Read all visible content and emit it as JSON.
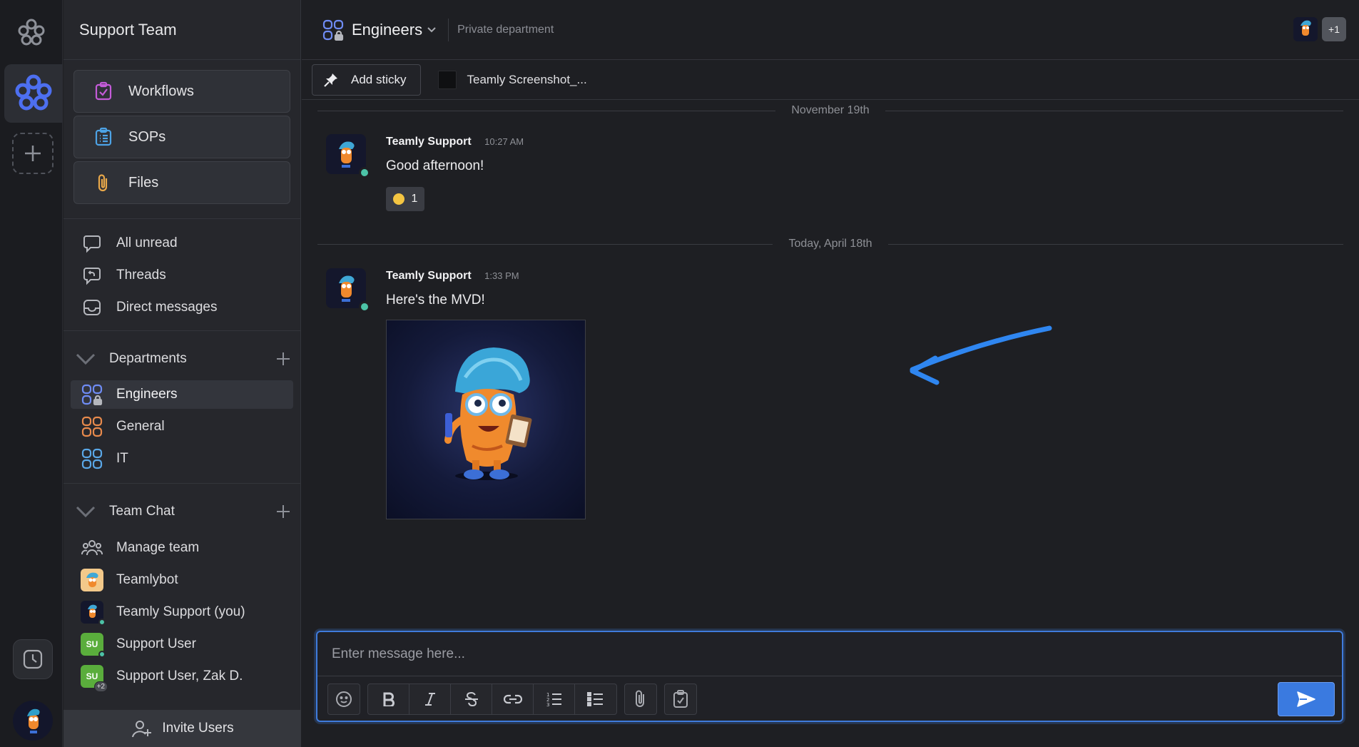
{
  "workspace": {
    "name": "Support Team"
  },
  "sidebar": {
    "big_buttons": [
      {
        "label": "Workflows",
        "icon": "workflows-icon"
      },
      {
        "label": "SOPs",
        "icon": "sops-icon"
      },
      {
        "label": "Files",
        "icon": "paperclip-icon"
      }
    ],
    "nav": [
      {
        "label": "All unread",
        "icon": "chat-bubble-icon"
      },
      {
        "label": "Threads",
        "icon": "threads-icon"
      },
      {
        "label": "Direct messages",
        "icon": "inbox-icon"
      }
    ],
    "departments": {
      "title": "Departments",
      "items": [
        {
          "label": "Engineers",
          "color": "#6f8cf5",
          "active": true
        },
        {
          "label": "General",
          "color": "#e88a4c"
        },
        {
          "label": "IT",
          "color": "#5aa8e8"
        }
      ]
    },
    "team_chat": {
      "title": "Team Chat",
      "items": [
        {
          "label": "Manage team",
          "icon": "people-icon"
        },
        {
          "label": "Teamlybot",
          "icon": "teamlybot-avatar"
        },
        {
          "label": "Teamly Support (you)",
          "icon": "teamly-support-avatar"
        },
        {
          "label": "Support User",
          "initials": "SU",
          "color": "#5aad3c"
        },
        {
          "label": "Support User, Zak D.",
          "initials": "SU",
          "color": "#5aad3c",
          "extra": "+2"
        }
      ]
    },
    "invite_label": "Invite Users"
  },
  "channel": {
    "title": "Engineers",
    "description": "Private department",
    "members_extra": "+1"
  },
  "stickies": {
    "add_label": "Add sticky",
    "file_tab": "Teamly Screenshot_..."
  },
  "messages": {
    "date1": "November 19th",
    "date2": "Today, April 18th",
    "m1": {
      "author": "Teamly Support",
      "time": "10:27 AM",
      "text": "Good afternoon!",
      "reaction_count": "1"
    },
    "m2": {
      "author": "Teamly Support",
      "time": "1:33 PM",
      "text": "Here's the MVD!"
    }
  },
  "composer": {
    "placeholder": "Enter message here..."
  },
  "colors": {
    "accent": "#3a7ae0",
    "online": "#4cc3a7",
    "arrow": "#2f86f0"
  }
}
